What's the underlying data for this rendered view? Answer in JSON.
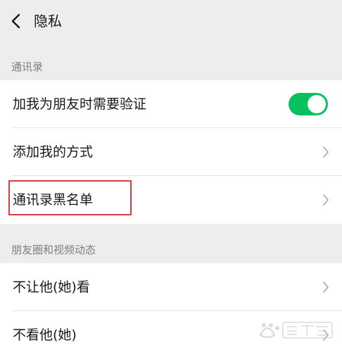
{
  "header": {
    "title": "隐私"
  },
  "sections": [
    {
      "title": "通讯录",
      "items": [
        {
          "label": "加我为朋友时需要验证",
          "control": "toggle",
          "toggle_on": true
        },
        {
          "label": "添加我的方式",
          "control": "chevron"
        },
        {
          "label": "通讯录黑名单",
          "control": "chevron",
          "highlighted": true
        }
      ]
    },
    {
      "title": "朋友圈和视频动态",
      "items": [
        {
          "label": "不让他(她)看",
          "control": "chevron"
        },
        {
          "label": "不看他(她)",
          "control": "chevron"
        }
      ]
    }
  ],
  "colors": {
    "toggle_on": "#07c160",
    "highlight_border": "#e0393e",
    "background": "#ededed"
  },
  "icons": {
    "back": "chevron-left-icon",
    "row_arrow": "chevron-right-icon"
  }
}
